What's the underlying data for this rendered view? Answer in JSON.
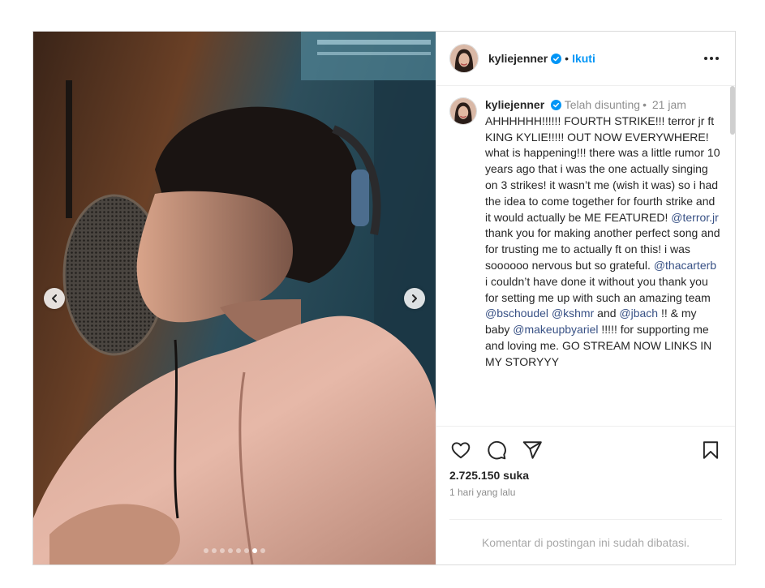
{
  "post": {
    "username": "kyliejenner",
    "separator": "•",
    "follow_label": "Ikuti",
    "carousel": {
      "total_slides": 8,
      "active_slide": 7
    }
  },
  "caption": {
    "username": "kyliejenner",
    "edited_label": "Telah disunting",
    "separator": "•",
    "time_ago": "21 jam",
    "segments": {
      "t1": "AHHHHHH!!!!!! FOURTH STRIKE!!! terror jr ft KING KYLIE!!!!! OUT NOW EVERYWHERE! what is happening!!! there was a little rumor 10 years ago that i was the one actually singing on 3 strikes! it wasn’t me (wish it was) so i had the idea to come together for fourth strike and it would actually be ME FEATURED! ",
      "m1": "@terror.jr",
      "t2": " thank you for making another perfect song and for trusting me to actually ft on this! i was soooooo nervous but so grateful. ",
      "m2": "@thacarterb",
      "t3": " i couldn’t have done it without you thank you for setting me up with such an amazing team ",
      "m3": "@bschoudel",
      "t4": " ",
      "m4": "@kshmr",
      "t5": " and ",
      "m5": "@jbach",
      "t6": " !! & my baby ",
      "m6": "@makeupbyariel",
      "t7": " !!!!! for supporting me and loving me. GO STREAM NOW LINKS IN MY STORYYY"
    }
  },
  "stats": {
    "likes": "2.725.150 suka",
    "posted": "1 hari yang lalu"
  },
  "footer": {
    "comments_limited": "Komentar di postingan ini sudah dibatasi."
  },
  "icons": {
    "like": "heart-icon",
    "comment": "comment-icon",
    "share": "share-icon",
    "save": "bookmark-icon",
    "more": "more-options-icon",
    "verified": "verified-badge-icon",
    "prev": "chevron-left-icon",
    "next": "chevron-right-icon"
  },
  "colors": {
    "accent": "#0095f6",
    "mention": "#385185",
    "muted": "#8e8e8e"
  }
}
